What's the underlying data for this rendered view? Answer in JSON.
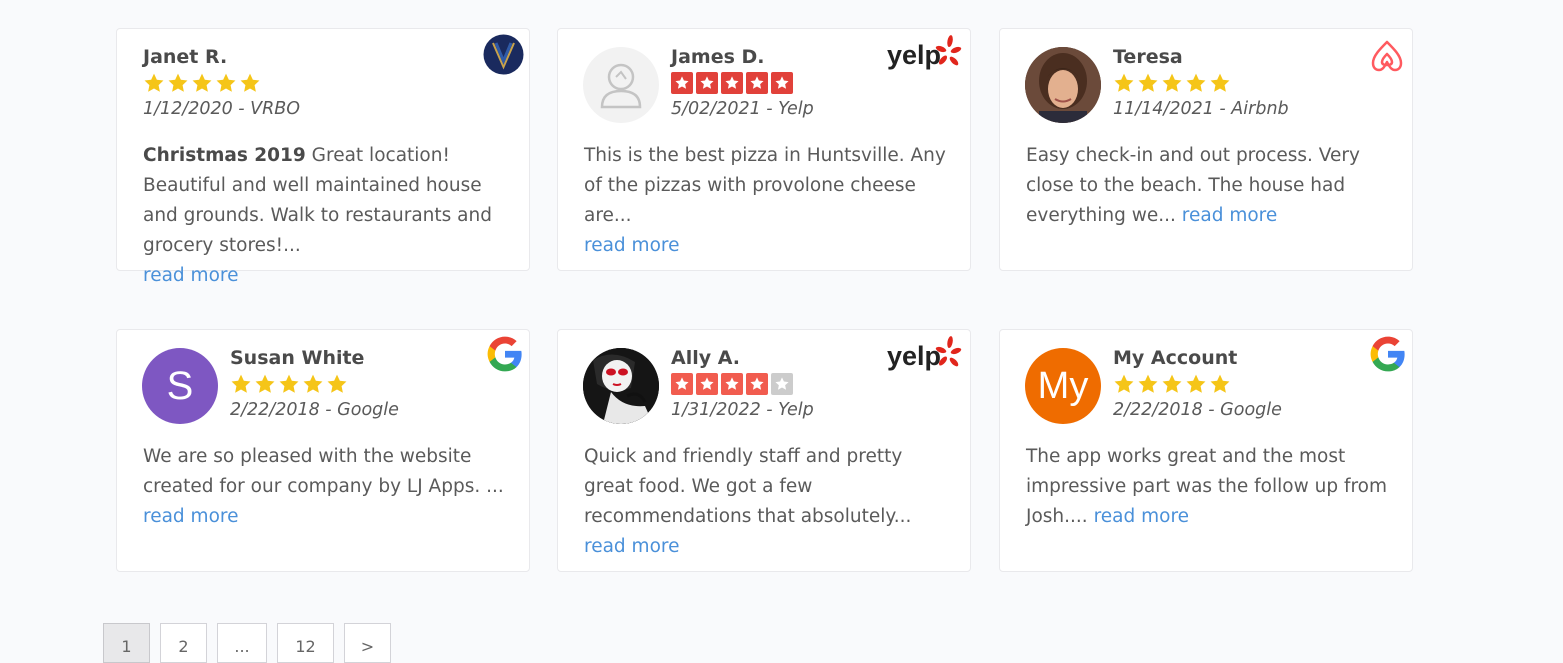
{
  "reviews": [
    {
      "name": "Janet R.",
      "date": "1/12/2020 - VRBO",
      "rating": 5,
      "source_icon": "vrbo-logo-icon",
      "title": "Christmas 2019",
      "text": "Great location! Beautiful and well maintained house and grounds. Walk to restaurants and grocery stores!...",
      "read_more": "read more"
    },
    {
      "name": "James D.",
      "date": "5/02/2021 - Yelp",
      "rating": 5,
      "source_icon": "yelp-logo-icon",
      "text": "This is the best pizza in Huntsville. Any of the pizzas with provolone cheese are...",
      "read_more": "read more"
    },
    {
      "name": "Teresa",
      "date": "11/14/2021 - Airbnb",
      "rating": 5,
      "source_icon": "airbnb-logo-icon",
      "text": "Easy check-in and out process. Very close to the beach. The house had everything we...",
      "read_more": "read more"
    },
    {
      "name": "Susan White",
      "date": "2/22/2018 - Google",
      "rating": 5,
      "source_icon": "google-logo-icon",
      "avatar_letter": "S",
      "text": "We are so pleased with the website created for our company by LJ Apps. ...",
      "read_more": "read more"
    },
    {
      "name": "Ally A.",
      "date": "1/31/2022 - Yelp",
      "rating": 4,
      "source_icon": "yelp-logo-icon",
      "text": "Quick and friendly staff and pretty great food. We got a few recommendations that absolutely...",
      "read_more": "read more"
    },
    {
      "name": "My Account",
      "date": "2/22/2018 - Google",
      "rating": 5,
      "source_icon": "google-logo-icon",
      "avatar_letter": "My",
      "text": "The app works great and the most impressive part was the follow up from Josh....",
      "read_more": "read more"
    }
  ],
  "yelp_logo_text": "yelp",
  "pagination": [
    "1",
    "2",
    "...",
    "12",
    ">"
  ],
  "current_page": "1",
  "colors": {
    "star_gold": "#f5c518",
    "yelp_red": "#e1413a",
    "link": "#4a90d9",
    "avatar_purple": "#7e57c2",
    "avatar_orange": "#ef6c00"
  }
}
